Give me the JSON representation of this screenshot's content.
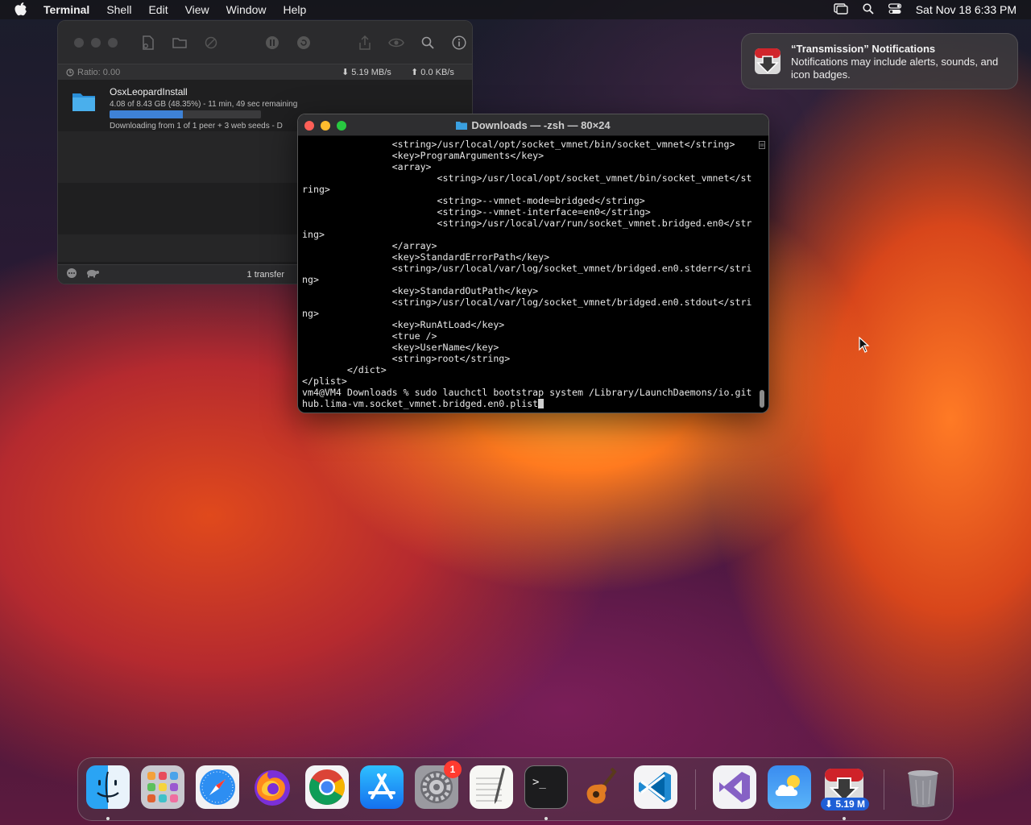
{
  "menubar": {
    "app_name": "Terminal",
    "items": [
      "Shell",
      "Edit",
      "View",
      "Window",
      "Help"
    ],
    "clock": "Sat Nov 18  6:33 PM"
  },
  "transmission": {
    "ratio": "Ratio: 0.00",
    "download_speed": "5.19 MB/s",
    "upload_speed": "0.0 KB/s",
    "torrent": {
      "name": "OsxLeopardInstall",
      "detail": "4.08 of 8.43 GB (48.35%) - 11 min, 49 sec remaining",
      "progress": 0.4835,
      "status": "Downloading from 1 of 1 peer + 3 web seeds - D"
    },
    "transfer_count": "1 transfer"
  },
  "notification": {
    "title": "“Transmission” Notifications",
    "body": "Notifications may include alerts, sounds, and icon badges."
  },
  "terminal": {
    "title": "Downloads — -zsh — 80×24",
    "lines": [
      "                <string>/usr/local/opt/socket_vmnet/bin/socket_vmnet</string>",
      "                <key>ProgramArguments</key>",
      "                <array>",
      "                        <string>/usr/local/opt/socket_vmnet/bin/socket_vmnet</st",
      "ring>",
      "                        <string>--vmnet-mode=bridged</string>",
      "                        <string>--vmnet-interface=en0</string>",
      "                        <string>/usr/local/var/run/socket_vmnet.bridged.en0</str",
      "ing>",
      "                </array>",
      "                <key>StandardErrorPath</key>",
      "                <string>/usr/local/var/log/socket_vmnet/bridged.en0.stderr</stri",
      "ng>",
      "                <key>StandardOutPath</key>",
      "                <string>/usr/local/var/log/socket_vmnet/bridged.en0.stdout</stri",
      "ng>",
      "                <key>RunAtLoad</key>",
      "                <true />",
      "                <key>UserName</key>",
      "                <string>root</string>",
      "        </dict>",
      "</plist>",
      "vm4@VM4 Downloads % sudo lauchctl bootstrap system /Library/LaunchDaemons/io.git",
      "hub.lima-vm.socket_vmnet.bridged.en0.plist"
    ]
  },
  "dock": {
    "apps": [
      {
        "name": "finder",
        "icon": "finder-icon",
        "running": true
      },
      {
        "name": "launchpad",
        "icon": "launchpad-icon",
        "running": false
      },
      {
        "name": "safari",
        "icon": "safari-icon",
        "running": false
      },
      {
        "name": "firefox",
        "icon": "firefox-icon",
        "running": false
      },
      {
        "name": "chrome",
        "icon": "chrome-icon",
        "running": false
      },
      {
        "name": "app-store",
        "icon": "app-store-icon",
        "running": false
      },
      {
        "name": "system-settings",
        "icon": "gear-icon",
        "running": false,
        "badge": "1"
      },
      {
        "name": "textedit",
        "icon": "textedit-icon",
        "running": false
      },
      {
        "name": "terminal",
        "icon": "terminal-icon",
        "running": true
      },
      {
        "name": "garageband",
        "icon": "guitar-icon",
        "running": false
      },
      {
        "name": "vscode",
        "icon": "vscode-icon",
        "running": false
      },
      {
        "name": "visual-studio",
        "icon": "visual-studio-icon",
        "running": false
      },
      {
        "name": "weather",
        "icon": "weather-icon",
        "running": false
      },
      {
        "name": "transmission",
        "icon": "transmission-icon",
        "running": true,
        "badge": "⬇ 5.19 M"
      },
      {
        "name": "trash",
        "icon": "trash-icon",
        "running": false
      }
    ]
  },
  "colors": {
    "progress_fill": "#3e82d6",
    "close": "#ff5f57",
    "minimize": "#febc2e",
    "zoom": "#28c840"
  }
}
